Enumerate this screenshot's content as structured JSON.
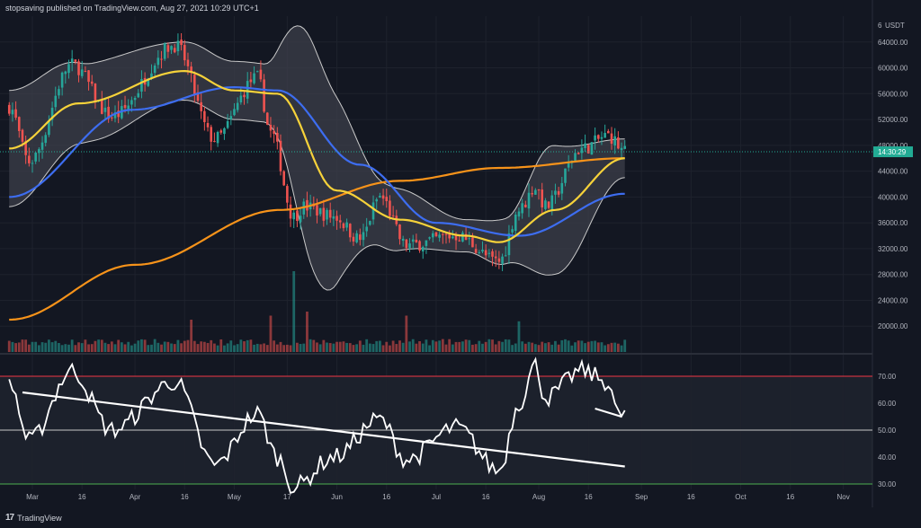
{
  "header": {
    "text": "stopsaving published on TradingView.com, Aug 27, 2021 10:29 UTC+1"
  },
  "footer": {
    "logo": "17",
    "brand": "TradingView"
  },
  "price_axis": {
    "currency": "USDT",
    "top_label": "6",
    "current_price_label": "14:30:29",
    "current_price": 47000,
    "ticks": [
      "64000.00",
      "60000.00",
      "56000.00",
      "52000.00",
      "48000.00",
      "44000.00",
      "40000.00",
      "36000.00",
      "32000.00",
      "28000.00",
      "24000.00",
      "20000.00"
    ]
  },
  "rsi_axis": {
    "ticks": [
      "70.00",
      "60.00",
      "50.00",
      "40.00",
      "30.00"
    ]
  },
  "time_axis": {
    "labels": [
      "Mar",
      "16",
      "Apr",
      "16",
      "May",
      "17",
      "Jun",
      "16",
      "Jul",
      "16",
      "Aug",
      "16",
      "Sep",
      "16",
      "Oct",
      "16",
      "Nov"
    ]
  },
  "colors": {
    "up": "#26a69a",
    "down": "#ef5350",
    "ma20": "#f6d23a",
    "ma50": "#3d6df0",
    "ma200": "#f7931a",
    "bb_fill": "#3c3f4a",
    "bb_line": "#c9c9c9",
    "rsi_line": "#ffffff",
    "rsi_upper": "#f23645",
    "rsi_mid": "#c9c9c9",
    "rsi_lower": "#4caf50",
    "price_tag": "#22ab94"
  },
  "chart_data": {
    "type": "candlestick",
    "symbol_currency": "USDT",
    "date_range": [
      "2021-02-22",
      "2021-08-27"
    ],
    "price_close_anchors": [
      {
        "date": "2021-02-22",
        "close": 54000
      },
      {
        "date": "2021-02-28",
        "close": 45500
      },
      {
        "date": "2021-03-13",
        "close": 60500
      },
      {
        "date": "2021-03-25",
        "close": 52500
      },
      {
        "date": "2021-04-13",
        "close": 63500
      },
      {
        "date": "2021-04-25",
        "close": 49000
      },
      {
        "date": "2021-05-08",
        "close": 58500
      },
      {
        "date": "2021-05-12",
        "close": 50000
      },
      {
        "date": "2021-05-19",
        "close": 37000
      },
      {
        "date": "2021-05-22",
        "close": 38500
      },
      {
        "date": "2021-05-31",
        "close": 37000
      },
      {
        "date": "2021-06-08",
        "close": 33500
      },
      {
        "date": "2021-06-14",
        "close": 40000
      },
      {
        "date": "2021-06-22",
        "close": 32500
      },
      {
        "date": "2021-07-07",
        "close": 34000
      },
      {
        "date": "2021-07-20",
        "close": 30000
      },
      {
        "date": "2021-07-26",
        "close": 38000
      },
      {
        "date": "2021-07-31",
        "close": 41500
      },
      {
        "date": "2021-08-03",
        "close": 38500
      },
      {
        "date": "2021-08-14",
        "close": 47500
      },
      {
        "date": "2021-08-22",
        "close": 49500
      },
      {
        "date": "2021-08-27",
        "close": 47000
      }
    ],
    "ma20_anchors": [
      {
        "date": "2021-02-22",
        "value": 47500
      },
      {
        "date": "2021-03-15",
        "value": 54500
      },
      {
        "date": "2021-04-16",
        "value": 59500
      },
      {
        "date": "2021-05-01",
        "value": 56500
      },
      {
        "date": "2021-05-14",
        "value": 56000
      },
      {
        "date": "2021-06-01",
        "value": 41000
      },
      {
        "date": "2021-06-20",
        "value": 36500
      },
      {
        "date": "2021-07-10",
        "value": 34000
      },
      {
        "date": "2021-07-20",
        "value": 33000
      },
      {
        "date": "2021-08-06",
        "value": 38000
      },
      {
        "date": "2021-08-27",
        "value": 46000
      }
    ],
    "ma50_anchors": [
      {
        "date": "2021-02-22",
        "value": 40000
      },
      {
        "date": "2021-03-31",
        "value": 53500
      },
      {
        "date": "2021-05-01",
        "value": 57000
      },
      {
        "date": "2021-05-14",
        "value": 56500
      },
      {
        "date": "2021-06-08",
        "value": 45000
      },
      {
        "date": "2021-07-01",
        "value": 36000
      },
      {
        "date": "2021-07-26",
        "value": 34000
      },
      {
        "date": "2021-08-27",
        "value": 40500
      }
    ],
    "ma200_anchors": [
      {
        "date": "2021-02-22",
        "value": 21000
      },
      {
        "date": "2021-04-01",
        "value": 29500
      },
      {
        "date": "2021-05-15",
        "value": 38000
      },
      {
        "date": "2021-06-20",
        "value": 42500
      },
      {
        "date": "2021-07-20",
        "value": 44500
      },
      {
        "date": "2021-08-27",
        "value": 46000
      }
    ],
    "bb_half_width_anchors": [
      {
        "date": "2021-02-22",
        "value": 9000
      },
      {
        "date": "2021-03-20",
        "value": 6000
      },
      {
        "date": "2021-04-16",
        "value": 4500
      },
      {
        "date": "2021-05-10",
        "value": 4500
      },
      {
        "date": "2021-05-25",
        "value": 17500
      },
      {
        "date": "2021-06-15",
        "value": 5000
      },
      {
        "date": "2021-07-10",
        "value": 2500
      },
      {
        "date": "2021-07-22",
        "value": 3500
      },
      {
        "date": "2021-08-05",
        "value": 10000
      },
      {
        "date": "2021-08-27",
        "value": 3000
      }
    ],
    "volume_relative_spikes": [
      {
        "date": "2021-05-19",
        "value": 1.0
      },
      {
        "date": "2021-05-12",
        "value": 0.45
      },
      {
        "date": "2021-05-23",
        "value": 0.5
      },
      {
        "date": "2021-06-22",
        "value": 0.45
      },
      {
        "date": "2021-04-18",
        "value": 0.4
      },
      {
        "date": "2021-07-26",
        "value": 0.38
      }
    ],
    "rsi_anchors": [
      {
        "date": "2021-02-22",
        "value": 68
      },
      {
        "date": "2021-02-28",
        "value": 46
      },
      {
        "date": "2021-03-13",
        "value": 72
      },
      {
        "date": "2021-03-25",
        "value": 50
      },
      {
        "date": "2021-04-13",
        "value": 68
      },
      {
        "date": "2021-04-25",
        "value": 37
      },
      {
        "date": "2021-05-08",
        "value": 56
      },
      {
        "date": "2021-05-14",
        "value": 40
      },
      {
        "date": "2021-05-19",
        "value": 29
      },
      {
        "date": "2021-05-31",
        "value": 40
      },
      {
        "date": "2021-06-14",
        "value": 54
      },
      {
        "date": "2021-06-22",
        "value": 39
      },
      {
        "date": "2021-07-07",
        "value": 51
      },
      {
        "date": "2021-07-20",
        "value": 35
      },
      {
        "date": "2021-07-26",
        "value": 60
      },
      {
        "date": "2021-07-31",
        "value": 74
      },
      {
        "date": "2021-08-03",
        "value": 62
      },
      {
        "date": "2021-08-14",
        "value": 72
      },
      {
        "date": "2021-08-22",
        "value": 68
      },
      {
        "date": "2021-08-25",
        "value": 55
      },
      {
        "date": "2021-08-27",
        "value": 57
      }
    ],
    "rsi_levels": [
      70,
      50,
      30
    ],
    "trendlines": [
      {
        "pane": "rsi",
        "from": {
          "date": "2021-02-26",
          "value": 64
        },
        "to": {
          "date": "2021-08-27",
          "value": 36.5
        }
      },
      {
        "pane": "rsi",
        "from": {
          "date": "2021-08-18",
          "value": 58
        },
        "to": {
          "date": "2021-08-26",
          "value": 55
        }
      }
    ],
    "price_ylim": [
      16000,
      68000
    ],
    "rsi_ylim": [
      28,
      78
    ],
    "grid": true
  }
}
